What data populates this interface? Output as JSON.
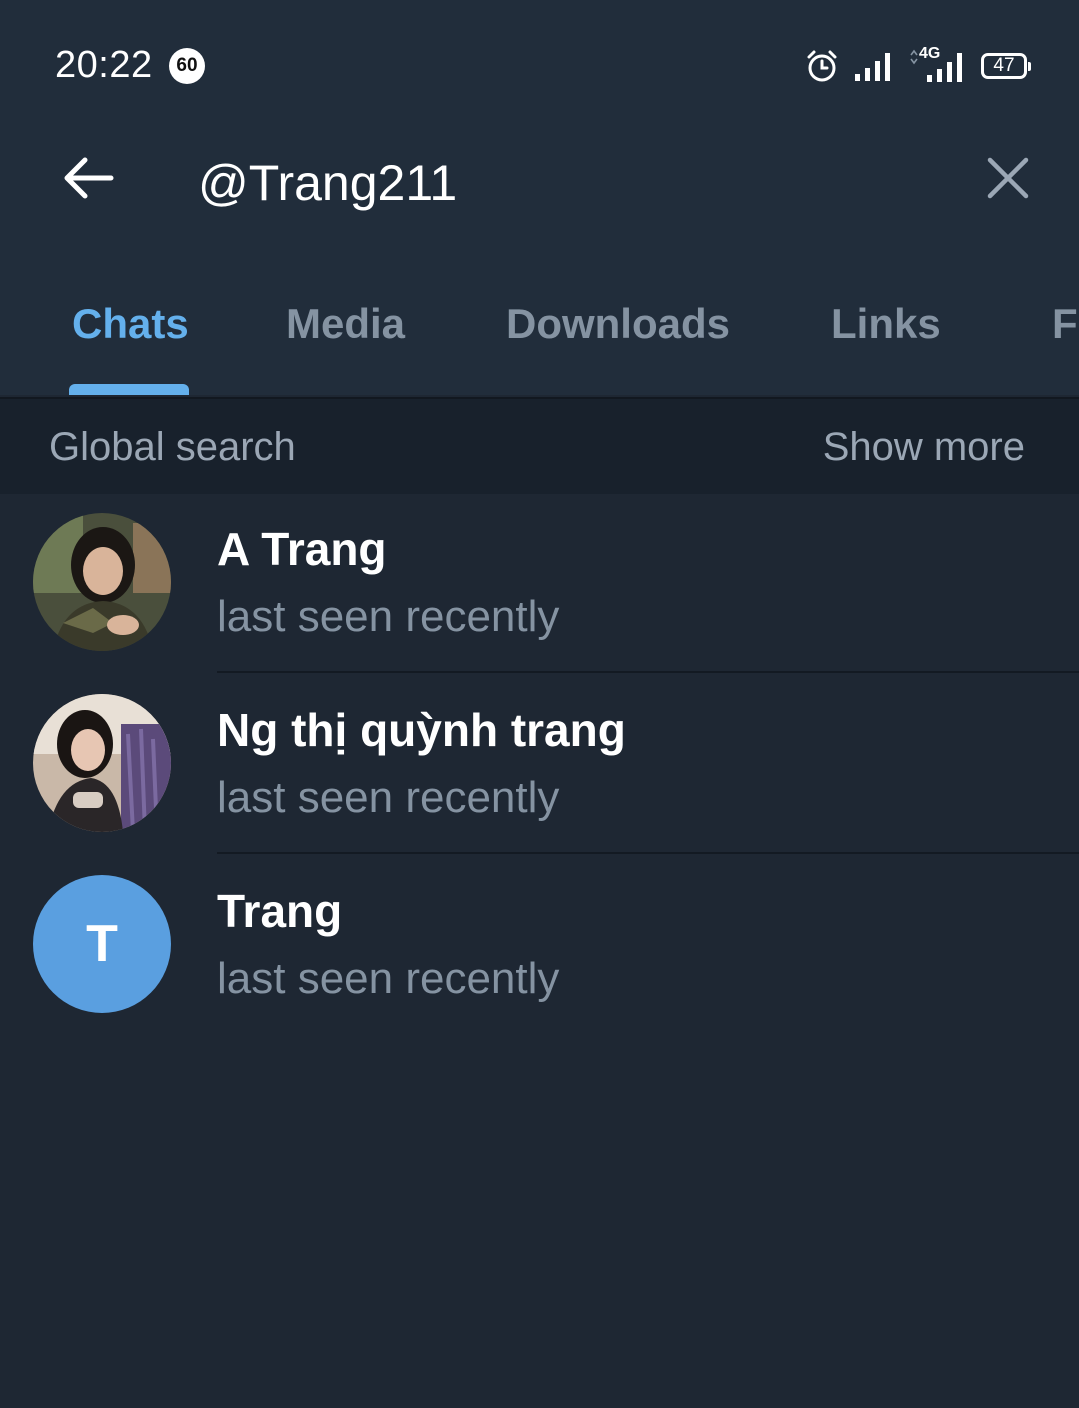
{
  "status_bar": {
    "time": "20:22",
    "notification_badge": "60",
    "network_type": "4G",
    "battery": "47",
    "icons": [
      "alarm-icon",
      "signal-icon",
      "signal-4g-icon",
      "battery-icon"
    ]
  },
  "header": {
    "back_icon": "arrow-left-icon",
    "search_value": "@Trang211",
    "clear_icon": "close-icon"
  },
  "tabs": [
    {
      "label": "Chats",
      "active": true
    },
    {
      "label": "Media",
      "active": false
    },
    {
      "label": "Downloads",
      "active": false
    },
    {
      "label": "Links",
      "active": false
    },
    {
      "label": "F",
      "active": false
    }
  ],
  "section": {
    "title": "Global search",
    "show_more": "Show more"
  },
  "results": [
    {
      "name": "A Trang",
      "status": "last seen recently",
      "avatar": "photo"
    },
    {
      "name": "Ng thị quỳnh trang",
      "status": "last seen recently",
      "avatar": "photo"
    },
    {
      "name": "Trang",
      "status": "last seen recently",
      "avatar_letter": "T",
      "avatar_color": "#5a9fe0"
    }
  ],
  "colors": {
    "background": "#1e2733",
    "header": "#212d3b",
    "accent": "#64b0ec",
    "secondary_text": "#8593a2"
  }
}
